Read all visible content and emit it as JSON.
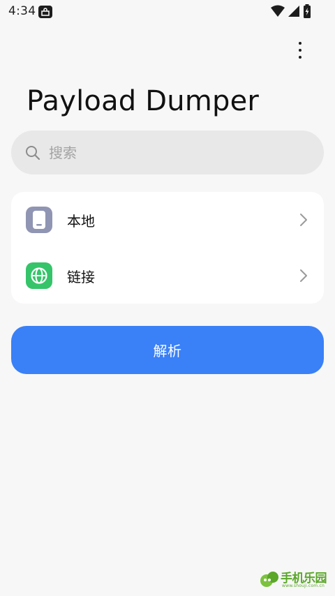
{
  "status_bar": {
    "time": "4:34",
    "icons": [
      "notification-lock-icon",
      "wifi-icon",
      "cellular-signal-icon",
      "battery-charging-icon"
    ]
  },
  "header": {
    "title": "Payload Dumper",
    "menu_icon": "more-vert-icon"
  },
  "search": {
    "placeholder": "搜索",
    "value": "",
    "icon": "search-icon"
  },
  "sources": {
    "items": [
      {
        "label": "本地",
        "icon": "phone-icon",
        "icon_color": "#8f95b2"
      },
      {
        "label": "链接",
        "icon": "globe-icon",
        "icon_color": "#35c46a"
      }
    ]
  },
  "actions": {
    "parse_label": "解析",
    "parse_color": "#3a80f7"
  },
  "watermark": {
    "text": "手机乐园",
    "sub": "www.shouji.com.cn",
    "color": "#5aa72a"
  }
}
